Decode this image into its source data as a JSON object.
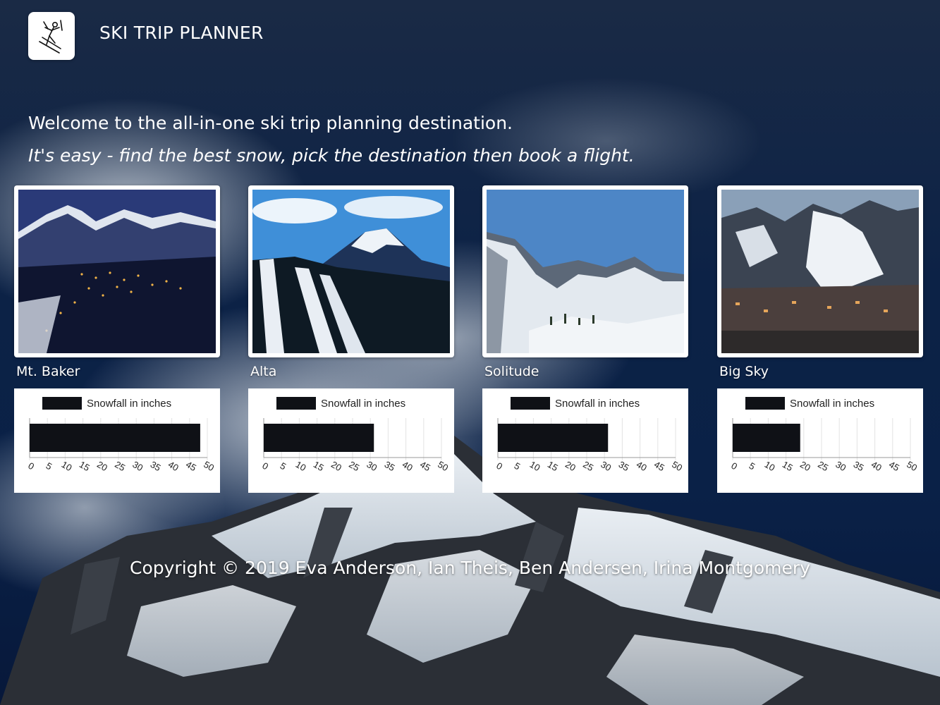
{
  "app": {
    "title": "SKI TRIP PLANNER",
    "logo_icon": "skier-icon"
  },
  "intro": {
    "welcome": "Welcome to the all-in-one ski trip planning destination.",
    "tagline": "It's easy - find the best snow, pick the destination then book a flight."
  },
  "resorts": [
    {
      "name": "Mt. Baker",
      "photo": "night-ski-town"
    },
    {
      "name": "Alta",
      "photo": "ski-slopes-peak"
    },
    {
      "name": "Solitude",
      "photo": "snowy-valley"
    },
    {
      "name": "Big Sky",
      "photo": "mountain-town"
    }
  ],
  "chart_data": [
    {
      "type": "bar",
      "orientation": "horizontal",
      "legend": "Snowfall in inches",
      "values": [
        48
      ],
      "xlim": [
        0,
        50
      ],
      "ticks": [
        "0",
        "5",
        "10",
        "15",
        "20",
        "25",
        "30",
        "35",
        "40",
        "45",
        "50"
      ],
      "color": "#0f1116"
    },
    {
      "type": "bar",
      "orientation": "horizontal",
      "legend": "Snowfall in inches",
      "values": [
        31
      ],
      "xlim": [
        0,
        50
      ],
      "ticks": [
        "0",
        "5",
        "10",
        "15",
        "20",
        "25",
        "30",
        "35",
        "40",
        "45",
        "50"
      ],
      "color": "#0f1116"
    },
    {
      "type": "bar",
      "orientation": "horizontal",
      "legend": "Snowfall in inches",
      "values": [
        31
      ],
      "xlim": [
        0,
        50
      ],
      "ticks": [
        "0",
        "5",
        "10",
        "15",
        "20",
        "25",
        "30",
        "35",
        "40",
        "45",
        "50"
      ],
      "color": "#0f1116"
    },
    {
      "type": "bar",
      "orientation": "horizontal",
      "legend": "Snowfall in inches",
      "values": [
        19
      ],
      "xlim": [
        0,
        50
      ],
      "ticks": [
        "0",
        "5",
        "10",
        "15",
        "20",
        "25",
        "30",
        "35",
        "40",
        "45",
        "50"
      ],
      "color": "#0f1116"
    }
  ],
  "footer": {
    "copyright": "Copyright © 2019 Eva Anderson, Ian Theis, Ben Andersen, Irina Montgomery"
  }
}
